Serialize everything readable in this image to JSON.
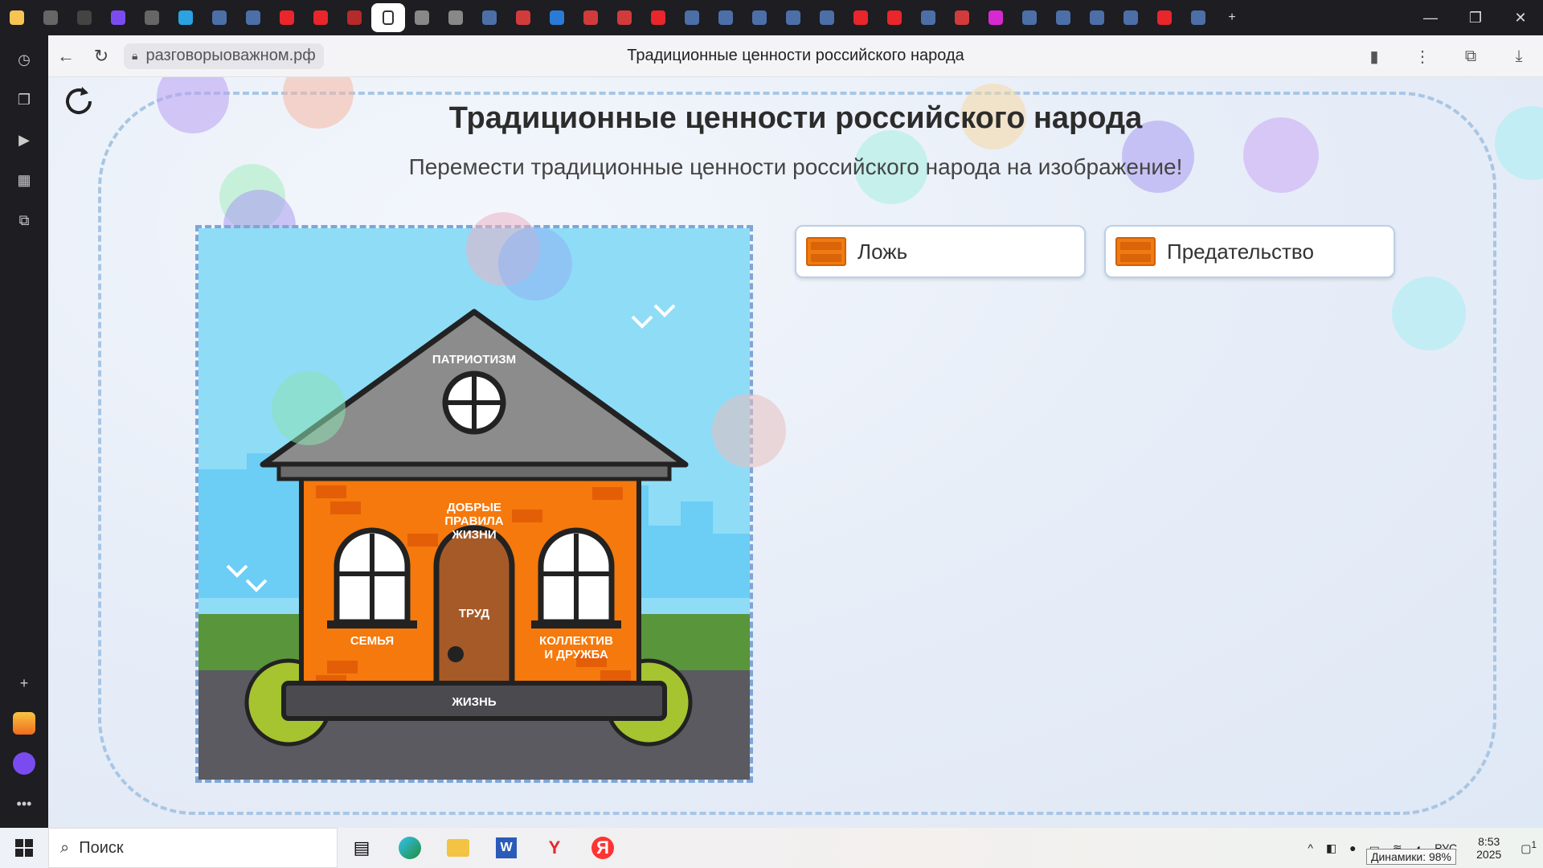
{
  "tabs": [
    {
      "icon": "yandex-browser-icon"
    },
    {
      "icon": "speaker-active-tab-icon"
    },
    {
      "icon": "chevron-down-icon"
    },
    {
      "icon": "alice-icon"
    },
    {
      "icon": "audio-icon"
    },
    {
      "icon": "telegram-icon"
    },
    {
      "icon": "app-icon"
    },
    {
      "icon": "app-icon"
    },
    {
      "icon": "yandex-icon"
    },
    {
      "icon": "yandex-icon"
    },
    {
      "icon": "bookmark-icon"
    },
    {
      "icon": "document-icon",
      "active": true
    },
    {
      "icon": "document-icon"
    },
    {
      "icon": "document-icon"
    },
    {
      "icon": "app-icon"
    },
    {
      "icon": "pdf-icon"
    },
    {
      "icon": "mail-icon"
    },
    {
      "icon": "pdf-icon"
    },
    {
      "icon": "pdf-icon"
    },
    {
      "icon": "yandex-icon"
    },
    {
      "icon": "app-icon"
    },
    {
      "icon": "app-icon"
    },
    {
      "icon": "app-icon"
    },
    {
      "icon": "app-icon"
    },
    {
      "icon": "app-icon"
    },
    {
      "icon": "yandex-icon"
    },
    {
      "icon": "yandex-icon"
    },
    {
      "icon": "app-icon"
    },
    {
      "icon": "pdf-icon"
    },
    {
      "icon": "video-icon"
    },
    {
      "icon": "app-icon"
    },
    {
      "icon": "app-icon"
    },
    {
      "icon": "app-icon"
    },
    {
      "icon": "app-icon"
    },
    {
      "icon": "yandex-icon"
    },
    {
      "icon": "app-icon"
    }
  ],
  "colors": {
    "accent": "#f07b0f",
    "sky": "#8fdcf7",
    "roof": "#8c8c8c",
    "wall": "#f5790c",
    "ground": "#5a9a3a"
  },
  "address": {
    "url": "разговорыоважном.рф",
    "page_title": "Традиционные ценности российского народа"
  },
  "page": {
    "heading": "Традиционные ценности российского народа",
    "subheading": "Перемести традиционные ценности российского народа на изображение!"
  },
  "house": {
    "roof_label": "ПАТРИОТИЗМ",
    "center_label_1": "ДОБРЫЕ",
    "center_label_2": "ПРАВИЛА",
    "center_label_3": "ЖИЗНИ",
    "door_label": "ТРУД",
    "left_label": "СЕМЬЯ",
    "right_label_1": "КОЛЛЕКТИВ",
    "right_label_2": "И ДРУЖБА",
    "base_label": "ЖИЗНЬ"
  },
  "cards": [
    {
      "label": "Ложь"
    },
    {
      "label": "Предательство"
    }
  ],
  "taskbar": {
    "search": "Поиск",
    "time": "8:53",
    "year": "2025",
    "lang": "РУС",
    "tooltip": "Динамики: 98%",
    "notif": "1"
  }
}
